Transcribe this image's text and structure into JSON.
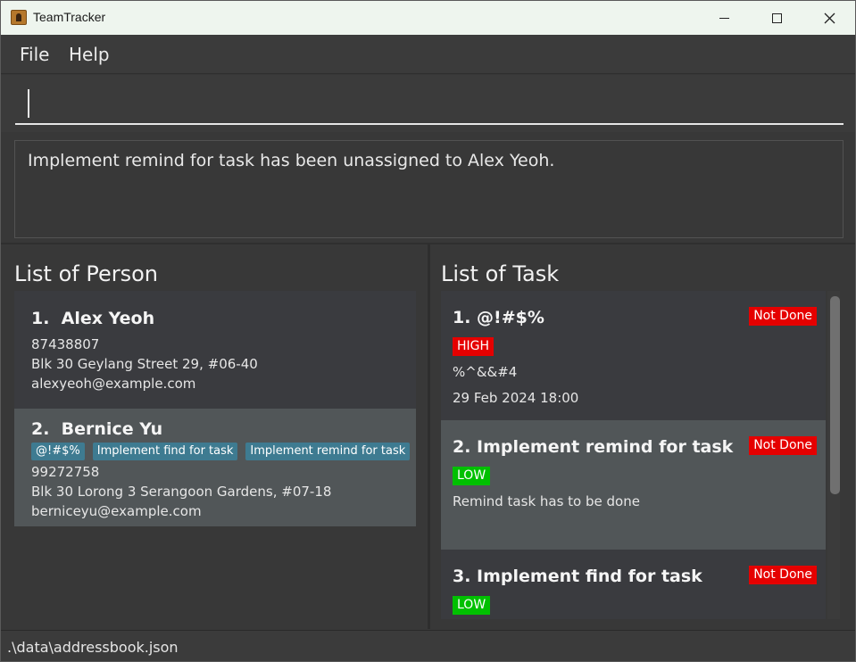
{
  "window": {
    "title": "TeamTracker"
  },
  "menu": {
    "file": "File",
    "help": "Help"
  },
  "command": {
    "value": ""
  },
  "result": {
    "text": "Implement remind for task has been unassigned to Alex Yeoh."
  },
  "persons": {
    "title": "List of Person",
    "items": [
      {
        "name": "1.  Alex Yeoh",
        "tags": [],
        "phone": "87438807",
        "address": "Blk 30 Geylang Street 29, #06-40",
        "email": "alexyeoh@example.com"
      },
      {
        "name": "2.  Bernice Yu",
        "tags": [
          "@!#$%",
          "Implement find for task",
          "Implement remind for task"
        ],
        "phone": "99272758",
        "address": "Blk 30 Lorong 3 Serangoon Gardens, #07-18",
        "email": "berniceyu@example.com"
      }
    ]
  },
  "tasks": {
    "title": "List of Task",
    "items": [
      {
        "title": "1. @!#$%",
        "status": "Not Done",
        "priority": "HIGH",
        "description": "%^&&#4",
        "deadline": "29 Feb 2024 18:00"
      },
      {
        "title": "2. Implement remind for task",
        "status": "Not Done",
        "priority": "LOW",
        "description": "Remind task has to be done",
        "deadline": ""
      },
      {
        "title": "3. Implement find for task",
        "status": "Not Done",
        "priority": "LOW",
        "description": "",
        "deadline": ""
      }
    ]
  },
  "statusbar": {
    "path": ".\\data\\addressbook.json"
  },
  "colors": {
    "background": "#383838",
    "tag": "#3e7b91",
    "status_not_done": "#e50000",
    "priority_high": "#e50000",
    "priority_low": "#00c000",
    "selected_card": "#515658"
  },
  "icons": {
    "app": "person-card-icon",
    "minimize": "minimize-icon",
    "maximize": "maximize-icon",
    "close": "close-icon"
  }
}
